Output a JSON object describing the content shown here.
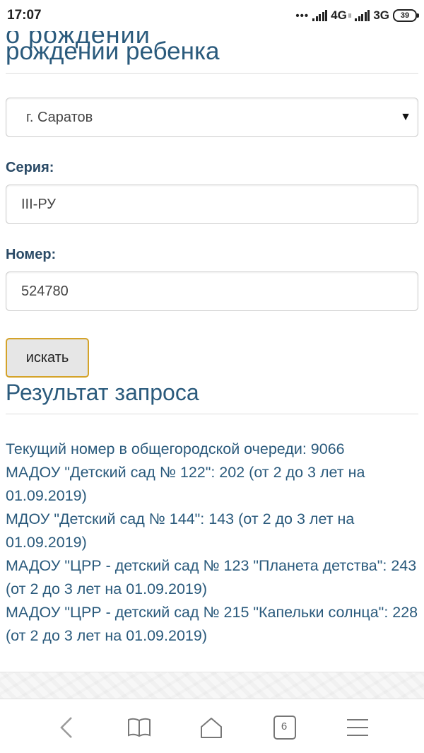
{
  "status_bar": {
    "time": "17:07",
    "dots": "•••",
    "network_1": "4G",
    "network_1_sub": "II",
    "network_2": "3G",
    "battery": "39"
  },
  "form": {
    "heading_clipped": "о рождении",
    "heading": "рождении ребенка",
    "city_select_value": "г. Саратов",
    "series_label": "Серия:",
    "series_value": "III-РУ",
    "number_label": "Номер:",
    "number_value": "524780",
    "search_button_label": "искать"
  },
  "results": {
    "title": "Результат запроса",
    "lines": [
      "Текущий номер в общегородской очереди: 9066",
      "МАДОУ \"Детский сад № 122\": 202 (от 2 до 3 лет на 01.09.2019)",
      "МДОУ \"Детский сад № 144\": 143 (от 2 до 3 лет на 01.09.2019)",
      "МАДОУ \"ЦРР - детский сад № 123 \"Планета детства\": 243 (от 2 до 3 лет на 01.09.2019)",
      "МАДОУ \"ЦРР - детский сад № 215 \"Капельки солнца\": 228 (от 2 до 3 лет на 01.09.2019)"
    ]
  },
  "nav_bar": {
    "tab_count": "6",
    "icons": [
      "back-icon",
      "bookmarks-icon",
      "home-icon",
      "tabs-icon",
      "menu-icon"
    ]
  },
  "colors": {
    "heading": "#2a5a7c",
    "button_border": "#d4a32a"
  }
}
